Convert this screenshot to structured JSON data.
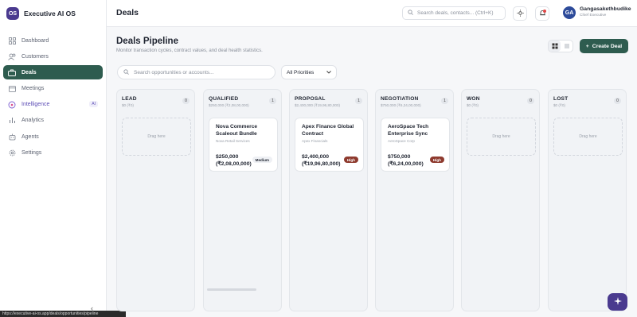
{
  "brand": {
    "logo": "OS",
    "name": "Executive AI OS"
  },
  "nav": [
    {
      "label": "Dashboard",
      "icon": "grid-icon"
    },
    {
      "label": "Customers",
      "icon": "users-icon"
    },
    {
      "label": "Deals",
      "icon": "briefcase-icon",
      "active": true
    },
    {
      "label": "Meetings",
      "icon": "calendar-icon"
    },
    {
      "label": "Intelligence",
      "icon": "brain-icon",
      "badge": "AI"
    },
    {
      "label": "Analytics",
      "icon": "chart-icon"
    },
    {
      "label": "Agents",
      "icon": "bot-icon"
    },
    {
      "label": "Settings",
      "icon": "gear-icon"
    }
  ],
  "collapse_glyph": "‹",
  "status_bar": "https://executive-ai-os.app/deals/opportunities/pipeline",
  "header": {
    "title": "Deals",
    "search_placeholder": "Search deals, contacts... (Ctrl+K)",
    "user": {
      "initials": "GA",
      "name": "Gangasakethbudike",
      "role": "Chief Executive"
    }
  },
  "main": {
    "title": "Deals Pipeline",
    "subtitle": "Monitor transaction cycles, contract values, and deal health statistics.",
    "create_label": "Create Deal",
    "opp_search_placeholder": "Search opportunities or accounts...",
    "priority_filter": "All Priorities"
  },
  "columns": [
    {
      "name": "LEAD",
      "sub": "$0 (₹0)",
      "count": "0",
      "empty_text": "Drag here"
    },
    {
      "name": "QUALIFIED",
      "sub": "$250,000 (₹2,08,00,000)",
      "count": "1"
    },
    {
      "name": "PROPOSAL",
      "sub": "$2,400,000 (₹19,96,80,000)",
      "count": "1"
    },
    {
      "name": "NEGOTIATION",
      "sub": "$750,000 (₹6,24,00,000)",
      "count": "1"
    },
    {
      "name": "WON",
      "sub": "$0 (₹0)",
      "count": "0",
      "empty_text": "Drag here"
    },
    {
      "name": "LOST",
      "sub": "$0 (₹0)",
      "count": "0",
      "empty_text": "Drag here"
    }
  ],
  "cards": [
    {
      "title": "Nova Commerce Scaleout Bundle",
      "company": "Nova Retail Services",
      "amount": "$250,000",
      "amount_inr": "(₹2,08,00,000)",
      "priority": "Medium"
    },
    {
      "title": "Apex Finance Global Contract",
      "company": "Apex Financials",
      "amount": "$2,400,000",
      "amount_inr": "(₹19,96,80,000)",
      "priority": "High"
    },
    {
      "title": "AeroSpace Tech Enterprise Sync",
      "company": "AeroSpace Corp",
      "amount": "$750,000",
      "amount_inr": "(₹6,24,00,000)",
      "priority": "High"
    }
  ],
  "colors": {
    "accent": "#2e5c4f",
    "brand": "#4a3a8f",
    "high": "#8e3a2e"
  }
}
